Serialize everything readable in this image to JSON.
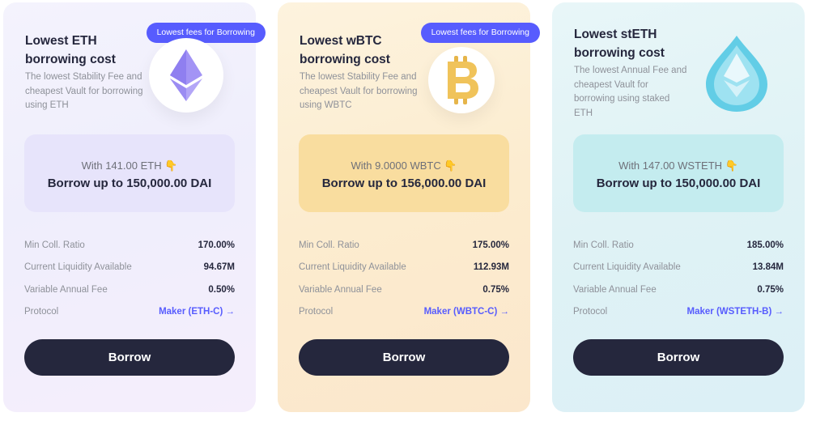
{
  "cards": [
    {
      "badge": "Lowest fees for Borrowing",
      "title": "Lowest ETH borrowing cost",
      "description": "The lowest Stability Fee and cheapest Vault for borrowing using ETH",
      "icon": "eth-token-icon",
      "with_text": "With 141.00 ETH",
      "borrow_text": "Borrow up to 150,000.00 DAI",
      "stats": {
        "min_coll_ratio_label": "Min Coll. Ratio",
        "min_coll_ratio": "170.00%",
        "liquidity_label": "Current Liquidity Available",
        "liquidity": "94.67M",
        "fee_label": "Variable Annual Fee",
        "fee": "0.50%",
        "protocol_label": "Protocol",
        "protocol": "Maker (ETH-C) →"
      },
      "button": "Borrow"
    },
    {
      "badge": "Lowest fees for Borrowing",
      "title": "Lowest wBTC borrowing cost",
      "description": "The lowest Stability Fee and cheapest Vault for borrowing using WBTC",
      "icon": "bitcoin-token-icon",
      "with_text": "With 9.0000 WBTC",
      "borrow_text": "Borrow up to 156,000.00 DAI",
      "stats": {
        "min_coll_ratio_label": "Min Coll. Ratio",
        "min_coll_ratio": "175.00%",
        "liquidity_label": "Current Liquidity Available",
        "liquidity": "112.93M",
        "fee_label": "Variable Annual Fee",
        "fee": "0.75%",
        "protocol_label": "Protocol",
        "protocol": "Maker (WBTC-C) →"
      },
      "button": "Borrow"
    },
    {
      "title": "Lowest stETH borrowing cost",
      "description": "The lowest Annual Fee and cheapest Vault for borrowing using staked ETH",
      "icon": "steth-token-icon",
      "with_text": "With 147.00 WSTETH",
      "borrow_text": "Borrow up to 150,000.00 DAI",
      "stats": {
        "min_coll_ratio_label": "Min Coll. Ratio",
        "min_coll_ratio": "185.00%",
        "liquidity_label": "Current Liquidity Available",
        "liquidity": "13.84M",
        "fee_label": "Variable Annual Fee",
        "fee": "0.75%",
        "protocol_label": "Protocol",
        "protocol": "Maker (WSTETH-B) →"
      },
      "button": "Borrow"
    }
  ],
  "hand_emoji": "👇",
  "colors": {
    "accent": "#575cfe",
    "button": "#25273d",
    "muted_text": "#8e9199"
  }
}
